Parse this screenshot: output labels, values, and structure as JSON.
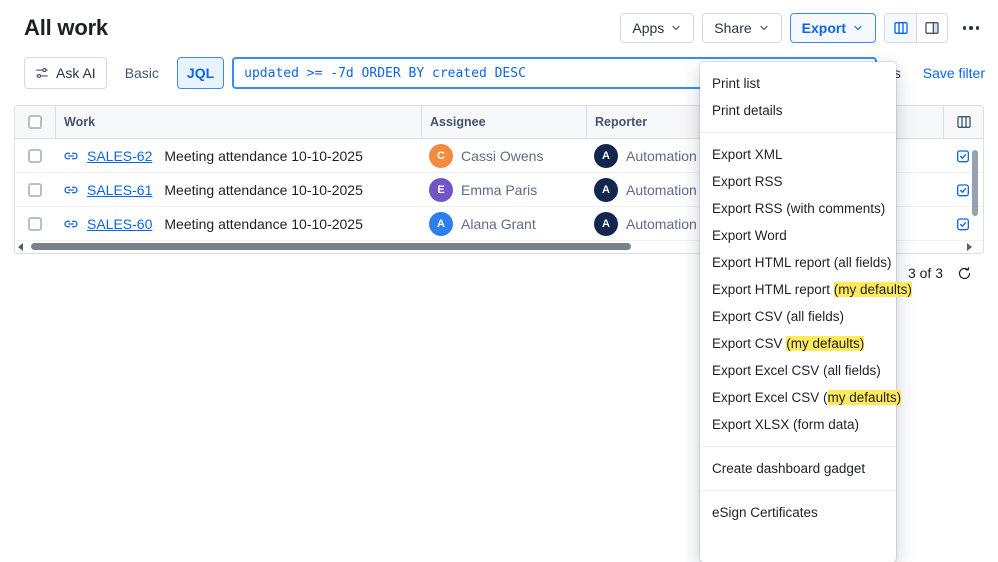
{
  "page": {
    "title": "All work"
  },
  "colors": {
    "accent": "#0C66E4",
    "selected_border": "#388BFF",
    "selected_bg": "#E9F2FF",
    "highlight": "#FFE95C",
    "link_icon": "#1868DB"
  },
  "toolbar": {
    "apps_label": "Apps",
    "share_label": "Share",
    "export_label": "Export"
  },
  "filter_bar": {
    "ask_ai_label": "Ask AI",
    "mode_basic_label": "Basic",
    "mode_jql_label": "JQL",
    "jql_query": "updated >= -7d ORDER BY created DESC",
    "filters_label_fragment": "rs",
    "save_filter_label": "Save filter"
  },
  "table": {
    "columns": [
      "Work",
      "Assignee",
      "Reporter"
    ],
    "rows": [
      {
        "key": "SALES-62",
        "summary": "Meeting attendance 10-10-2025",
        "assignee": {
          "name": "Cassi Owens",
          "initials": "C",
          "color": "#F38A3F"
        },
        "reporter": {
          "name": "Automation for",
          "initials": "A",
          "color": "#13264D"
        }
      },
      {
        "key": "SALES-61",
        "summary": "Meeting attendance 10-10-2025",
        "assignee": {
          "name": "Emma Paris",
          "initials": "E",
          "color": "#7056C6"
        },
        "reporter": {
          "name": "Automation for",
          "initials": "A",
          "color": "#13264D"
        }
      },
      {
        "key": "SALES-60",
        "summary": "Meeting attendance 10-10-2025",
        "assignee": {
          "name": "Alana Grant",
          "initials": "A",
          "color": "#2E7EF0"
        },
        "reporter": {
          "name": "Automation for",
          "initials": "A",
          "color": "#13264D"
        }
      }
    ],
    "footer": {
      "count_label": "3 of 3"
    }
  },
  "menu": {
    "sections": [
      {
        "items": [
          {
            "pre": "Print list"
          },
          {
            "pre": "Print details"
          }
        ]
      },
      {
        "items": [
          {
            "pre": "Export XML"
          },
          {
            "pre": "Export RSS"
          },
          {
            "pre": "Export RSS (with comments)"
          },
          {
            "pre": "Export Word"
          },
          {
            "pre": "Export HTML report (all fields)"
          },
          {
            "pre": "Export HTML report ",
            "hl": "(my defaults)"
          },
          {
            "pre": "Export CSV (all fields)"
          },
          {
            "pre": "Export CSV ",
            "hl": "(my defaults)"
          },
          {
            "pre": "Export Excel CSV (all fields)"
          },
          {
            "pre": "Export Excel CSV (",
            "hl": "my defaults)"
          },
          {
            "pre": "Export XLSX (form data)"
          }
        ]
      },
      {
        "items": [
          {
            "pre": "Create dashboard gadget"
          }
        ]
      },
      {
        "items": [
          {
            "pre": "eSign Certificates"
          }
        ]
      }
    ]
  }
}
